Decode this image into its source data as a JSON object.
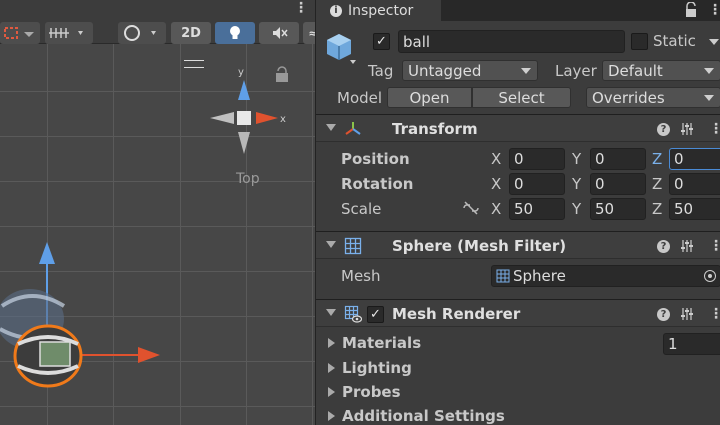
{
  "scene": {
    "toolbar": {
      "btn_2d": "2D"
    },
    "gizmo": {
      "label": "Top",
      "axis_y": "y",
      "axis_x": "x"
    }
  },
  "inspector": {
    "tab_label": "Inspector",
    "object": {
      "name": "ball",
      "active": true,
      "static_label": "Static",
      "tag_label": "Tag",
      "tag_value": "Untagged",
      "layer_label": "Layer",
      "layer_value": "Default",
      "model_label": "Model",
      "open_label": "Open",
      "select_label": "Select",
      "overrides_label": "Overrides"
    },
    "transform": {
      "title": "Transform",
      "position_label": "Position",
      "rotation_label": "Rotation",
      "scale_label": "Scale",
      "axis_x": "X",
      "axis_y": "Y",
      "axis_z": "Z",
      "position": {
        "x": "0",
        "y": "0",
        "z": "0"
      },
      "rotation": {
        "x": "0",
        "y": "0",
        "z": "0"
      },
      "scale": {
        "x": "50",
        "y": "50",
        "z": "50"
      }
    },
    "mesh_filter": {
      "title": "Sphere (Mesh Filter)",
      "mesh_label": "Mesh",
      "mesh_value": "Sphere"
    },
    "mesh_renderer": {
      "title": "Mesh Renderer",
      "enabled": true,
      "materials_label": "Materials",
      "materials_count": "1",
      "lighting_label": "Lighting",
      "probes_label": "Probes",
      "additional_label": "Additional Settings"
    }
  },
  "colors": {
    "accent_blue": "#4a6f9a",
    "x_axis": "#e0522e",
    "y_axis": "#5f9fe8",
    "selection_orange": "#f07a1a"
  }
}
